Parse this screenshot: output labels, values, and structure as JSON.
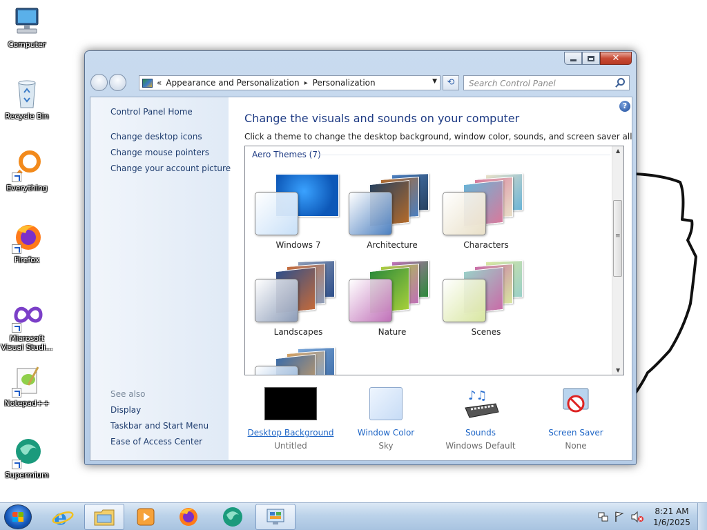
{
  "desktop": {
    "icons": [
      {
        "label": "Computer",
        "icon": "computer-icon"
      },
      {
        "label": "Recycle Bin",
        "icon": "recycle-bin-icon"
      },
      {
        "label": "Everything",
        "icon": "everything-search-icon"
      },
      {
        "label": "Firefox",
        "icon": "firefox-icon"
      },
      {
        "label": "Microsoft Visual Studi...",
        "icon": "visual-studio-icon"
      },
      {
        "label": "Notepad++",
        "icon": "notepad-plus-plus-icon"
      },
      {
        "label": "Supermium",
        "icon": "supermium-icon"
      }
    ]
  },
  "window": {
    "breadcrumb_prefix": "«",
    "breadcrumb": [
      "Appearance and Personalization",
      "Personalization"
    ],
    "breadcrumb_sep": "▸",
    "search_placeholder": "Search Control Panel",
    "sidebar": {
      "home": "Control Panel Home",
      "links": [
        "Change desktop icons",
        "Change mouse pointers",
        "Change your account picture"
      ],
      "see_also_label": "See also",
      "see_also": [
        "Display",
        "Taskbar and Start Menu",
        "Ease of Access Center"
      ]
    },
    "main": {
      "title": "Change the visuals and sounds on your computer",
      "subtitle": "Click a theme to change the desktop background, window color, sounds, and screen saver all at once.",
      "group_header": "Aero Themes (7)",
      "themes": [
        {
          "name": "Windows 7",
          "colors": [
            "#0d58b8",
            "#3aa2ff",
            "#c8e0f8"
          ]
        },
        {
          "name": "Architecture",
          "colors": [
            "#27415f",
            "#b36a2a",
            "#4b7fc0"
          ]
        },
        {
          "name": "Characters",
          "colors": [
            "#6ab4d6",
            "#d87a9c",
            "#e9e0c8"
          ]
        },
        {
          "name": "Landscapes",
          "colors": [
            "#2e4f8a",
            "#c46a3a",
            "#8c9cb8"
          ]
        },
        {
          "name": "Nature",
          "colors": [
            "#2c8a3a",
            "#a6cf3a",
            "#c070b8"
          ]
        },
        {
          "name": "Scenes",
          "colors": [
            "#9ad0c8",
            "#c96ca8",
            "#d8e6a0"
          ]
        },
        {
          "name": "",
          "colors": [
            "#3c6ca8",
            "#d4a060",
            "#7aa6d8"
          ]
        }
      ]
    },
    "bottom": {
      "background": {
        "label": "Desktop Background",
        "value": "Untitled"
      },
      "color": {
        "label": "Window Color",
        "value": "Sky"
      },
      "sounds": {
        "label": "Sounds",
        "value": "Windows Default"
      },
      "screensaver": {
        "label": "Screen Saver",
        "value": "None"
      }
    }
  },
  "taskbar": {
    "pinned": [
      "internet-explorer-icon",
      "file-explorer-icon",
      "media-player-icon",
      "firefox-icon",
      "supermium-icon",
      "control-panel-icon"
    ],
    "clock_time": "8:21 AM",
    "clock_date": "1/6/2025"
  },
  "colors": {
    "accent_title": "#1e3b84",
    "link": "#1f66c6"
  }
}
